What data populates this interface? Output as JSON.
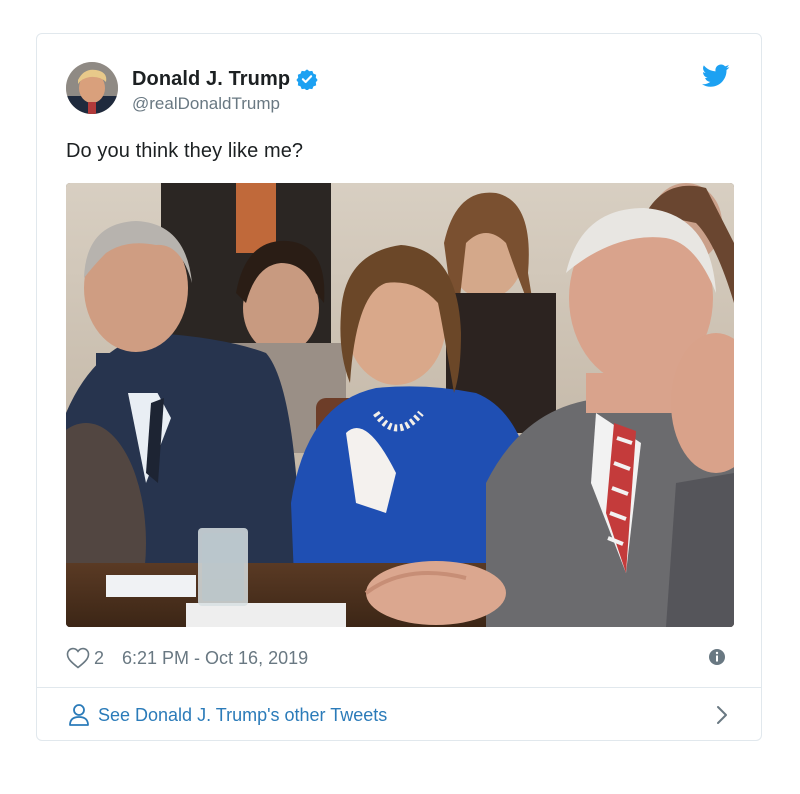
{
  "tweet": {
    "author": {
      "display_name": "Donald J. Trump",
      "handle": "@realDonaldTrump",
      "verified": true
    },
    "text": "Do you think they like me?",
    "likes": "2",
    "timestamp": "6:21 PM - Oct 16, 2019",
    "footer_label": "See Donald J. Trump's other Tweets"
  },
  "icons": {
    "verified": "verified-badge-icon",
    "brand": "twitter-bird-icon",
    "like": "heart-icon",
    "info": "info-icon",
    "profile": "person-icon",
    "chevron": "chevron-right-icon"
  },
  "colors": {
    "brand_blue": "#1da1f2",
    "link_blue": "#2b7bb9",
    "muted_text": "#697882",
    "border": "#e1e8ed"
  }
}
